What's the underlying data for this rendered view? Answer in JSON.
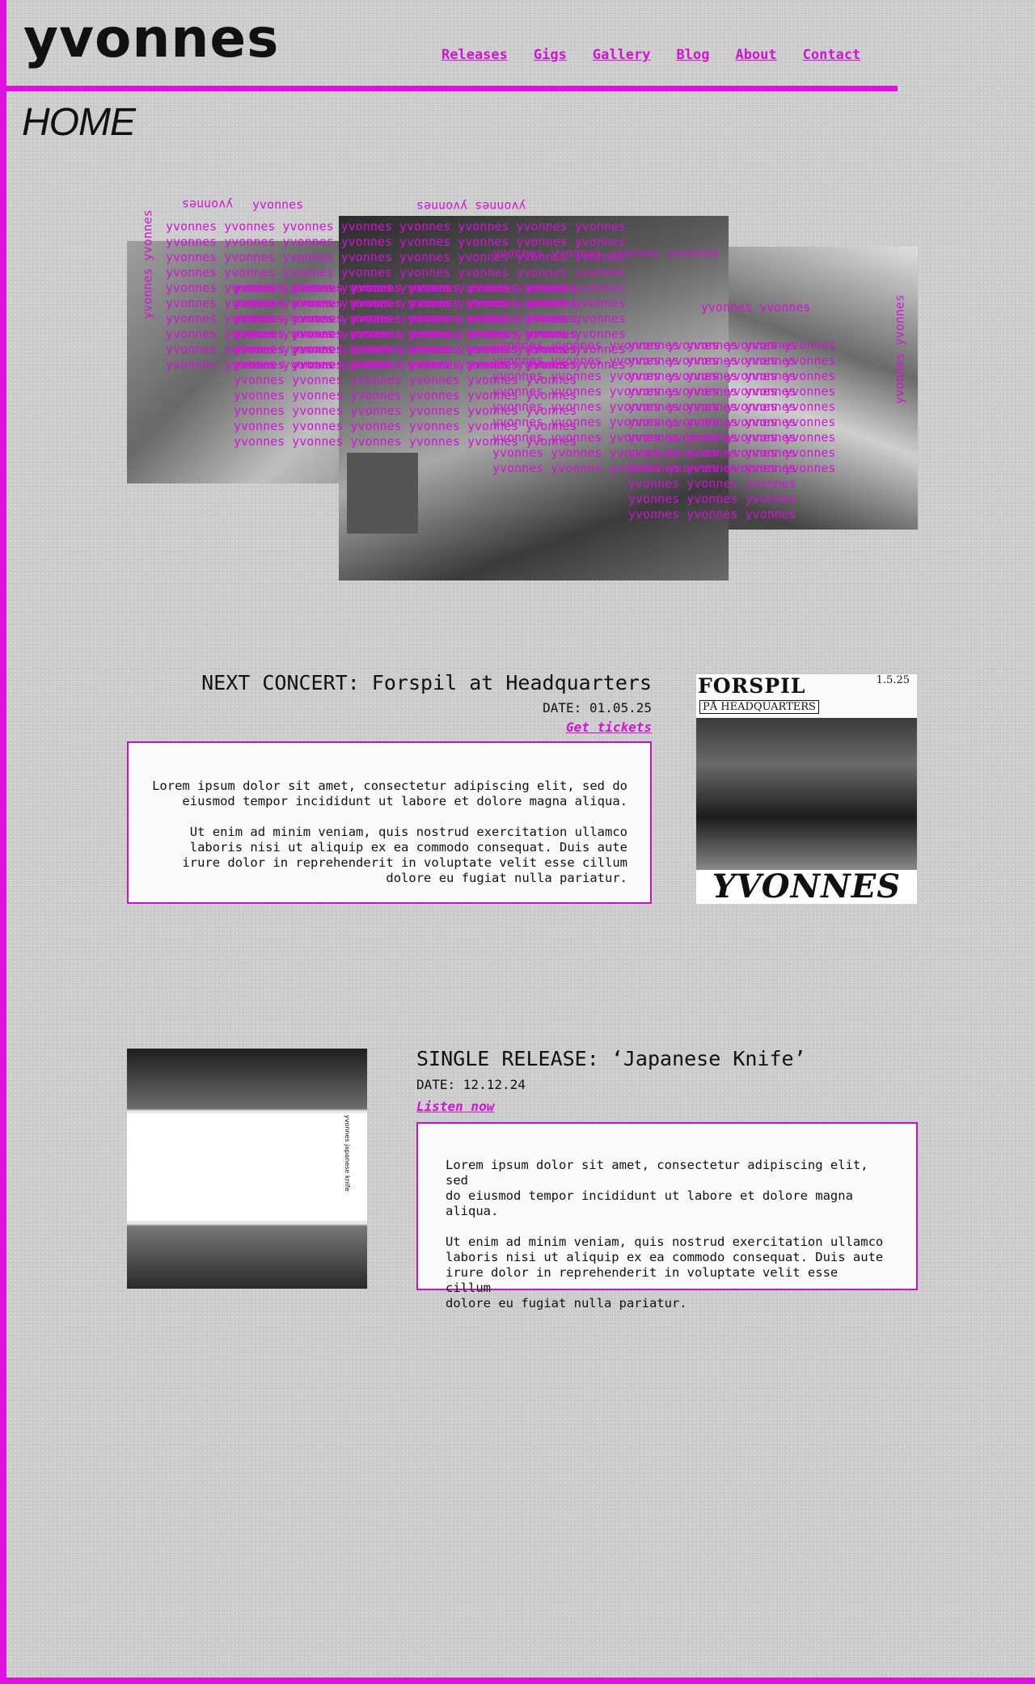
{
  "site": {
    "logo": "yvonnes",
    "accent_color": "#e010e0"
  },
  "nav": {
    "items": [
      "Releases",
      "Gigs",
      "Gallery",
      "Blog",
      "About",
      "Contact"
    ]
  },
  "page": {
    "title": "HOME"
  },
  "collage": {
    "word": "yvonnes"
  },
  "concert": {
    "title": "NEXT CONCERT: Forspil at Headquarters",
    "date": "DATE: 01.05.25",
    "link": "Get tickets",
    "paragraph1": "Lorem ipsum dolor sit amet, consectetur adipiscing elit, sed do\neiusmod  tempor incididunt ut labore et dolore magna aliqua.",
    "paragraph2": "Ut enim ad minim  veniam, quis nostrud exercitation ullamco\nlaboris nisi ut aliquip ex ea  commodo consequat. Duis aute\nirure dolor in reprehenderit in voluptate  velit esse cillum\ndolore eu fugiat nulla pariatur.",
    "poster": {
      "title": "FORSPIL",
      "subtitle": "PÅ HEADQUARTERS",
      "number": "1.5.25",
      "band": "YVONNES"
    }
  },
  "release": {
    "title": "SINGLE RELEASE: ‘Japanese Knife’",
    "date": "DATE: 12.12.24",
    "link": "Listen now",
    "cover_text": "yvonnes   japanese knife",
    "paragraph1": "Lorem ipsum dolor sit amet, consectetur adipiscing elit, sed\ndo eiusmod  tempor incididunt ut labore et dolore magna\naliqua.",
    "paragraph2": "Ut enim ad minim  veniam, quis nostrud exercitation ullamco\nlaboris nisi ut aliquip ex ea  commodo consequat. Duis aute\nirure dolor in reprehenderit in voluptate  velit esse cillum\ndolore eu fugiat nulla pariatur."
  }
}
